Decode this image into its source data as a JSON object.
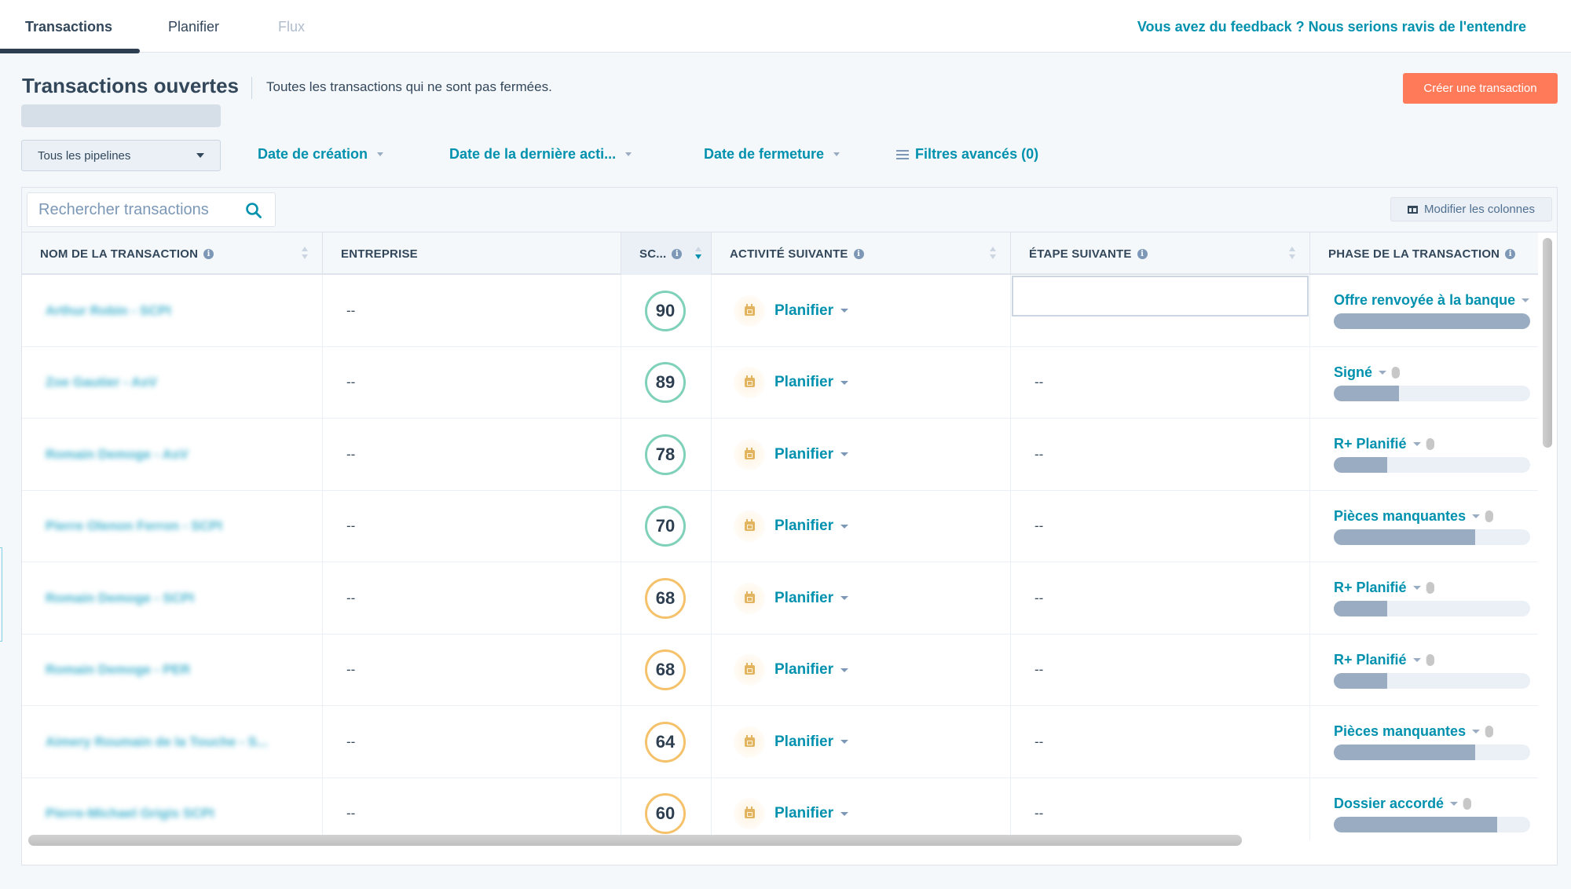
{
  "tabs": [
    {
      "label": "Transactions",
      "state": "active"
    },
    {
      "label": "Planifier",
      "state": "normal"
    },
    {
      "label": "Flux",
      "state": "disabled"
    }
  ],
  "feedback_link": "Vous avez du feedback ? Nous serions ravis de l'entendre",
  "header": {
    "title": "Transactions ouvertes",
    "description": "Toutes les transactions qui ne sont pas fermées.",
    "create_button": "Créer une transaction"
  },
  "filters": {
    "pipeline": "Tous les pipelines",
    "items": [
      {
        "label": "Date de création"
      },
      {
        "label": "Date de la dernière acti..."
      },
      {
        "label": "Date de fermeture"
      }
    ],
    "advanced": "Filtres avancés (0)"
  },
  "toolbar": {
    "search_placeholder": "Rechercher transactions",
    "modify_columns": "Modifier les colonnes"
  },
  "table": {
    "columns": [
      {
        "label": "NOM DE LA TRANSACTION",
        "info": true,
        "sortable": true
      },
      {
        "label": "ENTREPRISE",
        "info": false,
        "sortable": false
      },
      {
        "label": "SC...",
        "info": true,
        "sortable": true,
        "sorted": "desc"
      },
      {
        "label": "ACTIVITÉ SUIVANTE",
        "info": true,
        "sortable": true
      },
      {
        "label": "ÉTAPE SUIVANTE",
        "info": true,
        "sortable": true
      },
      {
        "label": "PHASE DE LA TRANSACTION",
        "info": true,
        "sortable": false
      }
    ],
    "rows": [
      {
        "name": "Arthur Robin - SCPI",
        "company": "--",
        "score": "90",
        "score_level": "high",
        "activity": "Planifier",
        "next_step": "",
        "phase": "Offre renvoyée à la banque",
        "progress": 1.0
      },
      {
        "name": "Zoe Gautier - AsV",
        "company": "--",
        "score": "89",
        "score_level": "high",
        "activity": "Planifier",
        "next_step": "--",
        "phase": "Signé",
        "progress": 0.33
      },
      {
        "name": "Romain Demoge - AsV",
        "company": "--",
        "score": "78",
        "score_level": "high",
        "activity": "Planifier",
        "next_step": "--",
        "phase": "R+ Planifié",
        "progress": 0.27
      },
      {
        "name": "Pierre Olenon Ferron - SCPI",
        "company": "--",
        "score": "70",
        "score_level": "high",
        "activity": "Planifier",
        "next_step": "--",
        "phase": "Pièces manquantes",
        "progress": 0.72
      },
      {
        "name": "Romain Demoge - SCPI",
        "company": "--",
        "score": "68",
        "score_level": "mid",
        "activity": "Planifier",
        "next_step": "--",
        "phase": "R+ Planifié",
        "progress": 0.27
      },
      {
        "name": "Romain Demoge - PER",
        "company": "--",
        "score": "68",
        "score_level": "mid",
        "activity": "Planifier",
        "next_step": "--",
        "phase": "R+ Planifié",
        "progress": 0.27
      },
      {
        "name": "Aimery Roumain de la Touche - S...",
        "company": "--",
        "score": "64",
        "score_level": "mid",
        "activity": "Planifier",
        "next_step": "--",
        "phase": "Pièces manquantes",
        "progress": 0.72
      },
      {
        "name": "Pierre-Michael Grigis SCPI",
        "company": "--",
        "score": "60",
        "score_level": "mid",
        "activity": "Planifier",
        "next_step": "--",
        "phase": "Dossier accordé",
        "progress": 0.83
      }
    ]
  },
  "colors": {
    "accent": "#0091ae",
    "primary_button": "#ff7a59",
    "score_high": "#7fd1b9",
    "score_mid": "#f5c26b",
    "progress_fill": "#99acc2"
  }
}
